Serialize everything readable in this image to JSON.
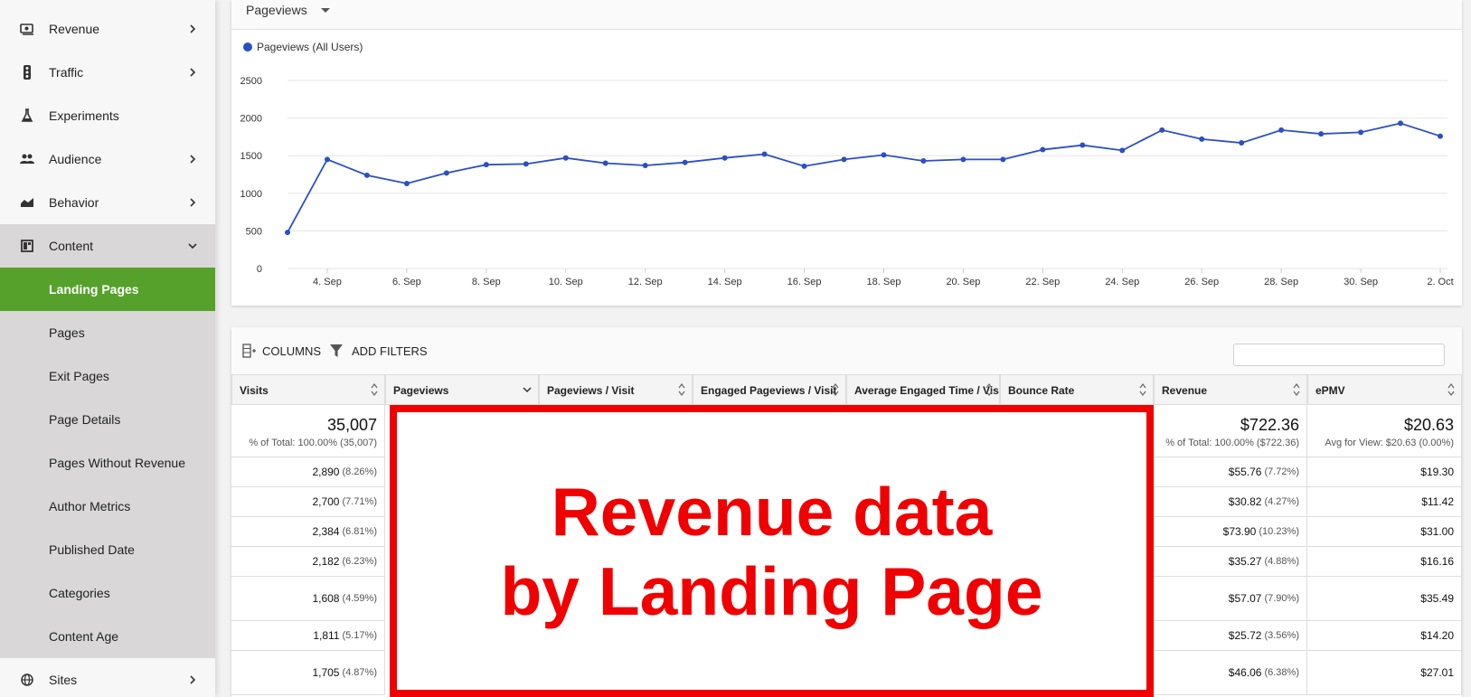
{
  "sidebar": {
    "items": [
      {
        "label": "Revenue",
        "icon": "money-icon",
        "chevron": "right"
      },
      {
        "label": "Traffic",
        "icon": "traffic-light-icon",
        "chevron": "right"
      },
      {
        "label": "Experiments",
        "icon": "flask-icon",
        "chevron": ""
      },
      {
        "label": "Audience",
        "icon": "people-icon",
        "chevron": "right"
      },
      {
        "label": "Behavior",
        "icon": "area-chart-icon",
        "chevron": "right"
      },
      {
        "label": "Content",
        "icon": "dashboard-icon",
        "chevron": "down"
      }
    ],
    "sub_items": [
      {
        "label": "Landing Pages",
        "active": true
      },
      {
        "label": "Pages"
      },
      {
        "label": "Exit Pages"
      },
      {
        "label": "Page Details"
      },
      {
        "label": "Pages Without Revenue"
      },
      {
        "label": "Author Metrics"
      },
      {
        "label": "Published Date"
      },
      {
        "label": "Categories"
      },
      {
        "label": "Content Age"
      }
    ],
    "footer_item": {
      "label": "Sites",
      "icon": "globe-icon",
      "chevron": "right"
    }
  },
  "chart_card": {
    "metric_select": "Pageviews"
  },
  "chart_data": {
    "type": "line",
    "series": [
      {
        "name": "Pageviews (All Users)",
        "color": "#2c4fc4",
        "values": [
          480,
          1450,
          1240,
          1130,
          1270,
          1380,
          1390,
          1470,
          1400,
          1370,
          1410,
          1470,
          1520,
          1360,
          1450,
          1510,
          1430,
          1450,
          1450,
          1580,
          1640,
          1570,
          1840,
          1720,
          1670,
          1840,
          1790,
          1810,
          1930,
          1760
        ]
      }
    ],
    "x": [
      "3. Sep",
      "4. Sep",
      "5. Sep",
      "6. Sep",
      "7. Sep",
      "8. Sep",
      "9. Sep",
      "10. Sep",
      "11. Sep",
      "12. Sep",
      "13. Sep",
      "14. Sep",
      "15. Sep",
      "16. Sep",
      "17. Sep",
      "18. Sep",
      "19. Sep",
      "20. Sep",
      "21. Sep",
      "22. Sep",
      "23. Sep",
      "24. Sep",
      "25. Sep",
      "26. Sep",
      "27. Sep",
      "28. Sep",
      "29. Sep",
      "30. Sep",
      "1. Oct",
      "2. Oct"
    ],
    "x_tick_labels": [
      "4. Sep",
      "6. Sep",
      "8. Sep",
      "10. Sep",
      "12. Sep",
      "14. Sep",
      "16. Sep",
      "18. Sep",
      "20. Sep",
      "22. Sep",
      "24. Sep",
      "26. Sep",
      "28. Sep",
      "30. Sep",
      "2. Oct"
    ],
    "y_ticks": [
      0,
      500,
      1000,
      1500,
      2000,
      2500
    ],
    "ylim": [
      0,
      2500
    ],
    "grid": true,
    "legend": "top-left"
  },
  "table": {
    "toolbar": {
      "columns_label": "Columns",
      "filters_label": "Add Filters",
      "search_placeholder": ""
    },
    "columns": [
      "Visits",
      "Pageviews",
      "Pageviews / Visit",
      "Engaged Pageviews / Visit",
      "Average Engaged Time / Visit",
      "Bounce Rate",
      "Revenue",
      "ePMV"
    ],
    "totals": {
      "visits": "35,007",
      "visits_sub": "% of Total: 100.00% (35,007)",
      "revenue": "$722.36",
      "revenue_sub": "% of Total: 100.00% ($722.36)",
      "epmv": "$20.63",
      "epmv_sub": "Avg for View: $20.63 (0.00%)"
    },
    "rows": [
      {
        "visits": "2,890",
        "visits_pct": "(8.26%)",
        "revenue": "$55.76",
        "revenue_pct": "(7.72%)",
        "epmv": "$19.30"
      },
      {
        "visits": "2,700",
        "visits_pct": "(7.71%)",
        "revenue": "$30.82",
        "revenue_pct": "(4.27%)",
        "epmv": "$11.42"
      },
      {
        "visits": "2,384",
        "visits_pct": "(6.81%)",
        "revenue": "$73.90",
        "revenue_pct": "(10.23%)",
        "epmv": "$31.00"
      },
      {
        "visits": "2,182",
        "visits_pct": "(6.23%)",
        "revenue": "$35.27",
        "revenue_pct": "(4.88%)",
        "epmv": "$16.16"
      },
      {
        "visits": "1,608",
        "visits_pct": "(4.59%)",
        "revenue": "$57.07",
        "revenue_pct": "(7.90%)",
        "epmv": "$35.49"
      },
      {
        "visits": "1,811",
        "visits_pct": "(5.17%)",
        "revenue": "$25.72",
        "revenue_pct": "(3.56%)",
        "epmv": "$14.20"
      },
      {
        "visits": "1,705",
        "visits_pct": "(4.87%)",
        "revenue": "$46.06",
        "revenue_pct": "(6.38%)",
        "epmv": "$27.01"
      }
    ]
  },
  "overlay": {
    "line1": "Revenue data",
    "line2": "by Landing Page",
    "color": "#f00000"
  }
}
